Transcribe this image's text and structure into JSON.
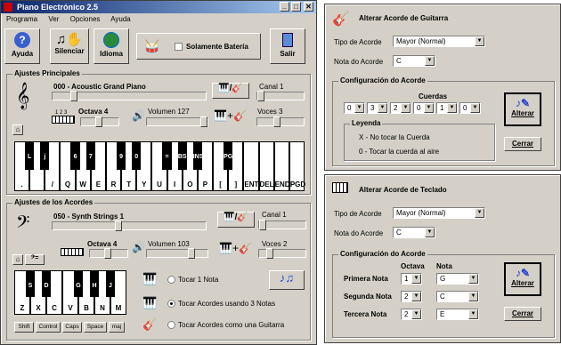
{
  "main": {
    "title": "Piano Electrónico 2.5",
    "menu": [
      "Programa",
      "Ver",
      "Opciones",
      "Ayuda"
    ],
    "toolbar": {
      "help": "Ayuda",
      "silence": "Silenciar",
      "language": "Idioma",
      "drums_only": "Solamente Batería",
      "exit": "Salir"
    },
    "main_settings": {
      "title": "Ajustes Principales",
      "instrument": "000 - Acoustic Grand Piano",
      "channel_label": "Canal 1",
      "octave_label": "Octava 4",
      "volume_label": "Volumen 127",
      "voices_label": "Voces 3",
      "octave_scale": "1 2 3"
    },
    "top_keys": {
      "black": [
        "L",
        "j",
        "",
        "6",
        "7",
        "",
        "9",
        "0",
        "",
        "=",
        "BS",
        "INS",
        "",
        "PGU"
      ],
      "white": [
        ".",
        "",
        "/",
        "Q",
        "W",
        "E",
        "R",
        "T",
        "Y",
        "U",
        "I",
        "O",
        "P",
        "[",
        "]",
        "ENT",
        "DEL",
        "END",
        "PGD"
      ]
    },
    "chord_settings": {
      "title": "Ajustes de los Acordes",
      "instrument": "050 - Synth Strings 1",
      "channel_label": "Canal 1",
      "octave_label": "Octava 4",
      "volume_label": "Volumen 103",
      "voices_label": "Voces 2"
    },
    "bottom_keys": {
      "black": [
        "S",
        "D",
        "",
        "G",
        "H",
        "J"
      ],
      "white": [
        "Z",
        "X",
        "C",
        "V",
        "B",
        "N",
        "M"
      ],
      "mods": [
        "Shift",
        "Control",
        "Caps",
        "Space",
        "maj"
      ]
    },
    "options": [
      "Tocar 1 Nota",
      "Tocar Acordes usando 3 Notas",
      "Tocar Acordes como una Guitarra"
    ]
  },
  "guitar": {
    "title": "Alterar Acorde de Guitarra",
    "type_label": "Tipo de Acorde",
    "type_value": "Mayor (Normal)",
    "note_label": "Nota do Acorde",
    "note_value": "C",
    "config_title": "Configuración do Acorde",
    "strings_label": "Cuerdas",
    "strings": [
      "0",
      "3",
      "2",
      "0",
      "1",
      "0"
    ],
    "legend_title": "Leyenda",
    "legend": [
      "X - No tocar la Cuerda",
      "0 - Tocar la cuerda al aire"
    ],
    "alter": "Alterar",
    "close": "Cerrar"
  },
  "keyboard": {
    "title": "Alterar Acorde de Teclado",
    "type_label": "Tipo de Acorde",
    "type_value": "Mayor (Normal)",
    "note_label": "Nota do Acorde",
    "note_value": "C",
    "config_title": "Configuración do Acorde",
    "octave_col": "Octava",
    "note_col": "Nota",
    "rows": [
      {
        "label": "Primera Nota",
        "octave": "1",
        "note": "G"
      },
      {
        "label": "Segunda Nota",
        "octave": "2",
        "note": "C"
      },
      {
        "label": "Tercera Nota",
        "octave": "2",
        "note": "E"
      }
    ],
    "alter": "Alterar",
    "close": "Cerrar"
  }
}
